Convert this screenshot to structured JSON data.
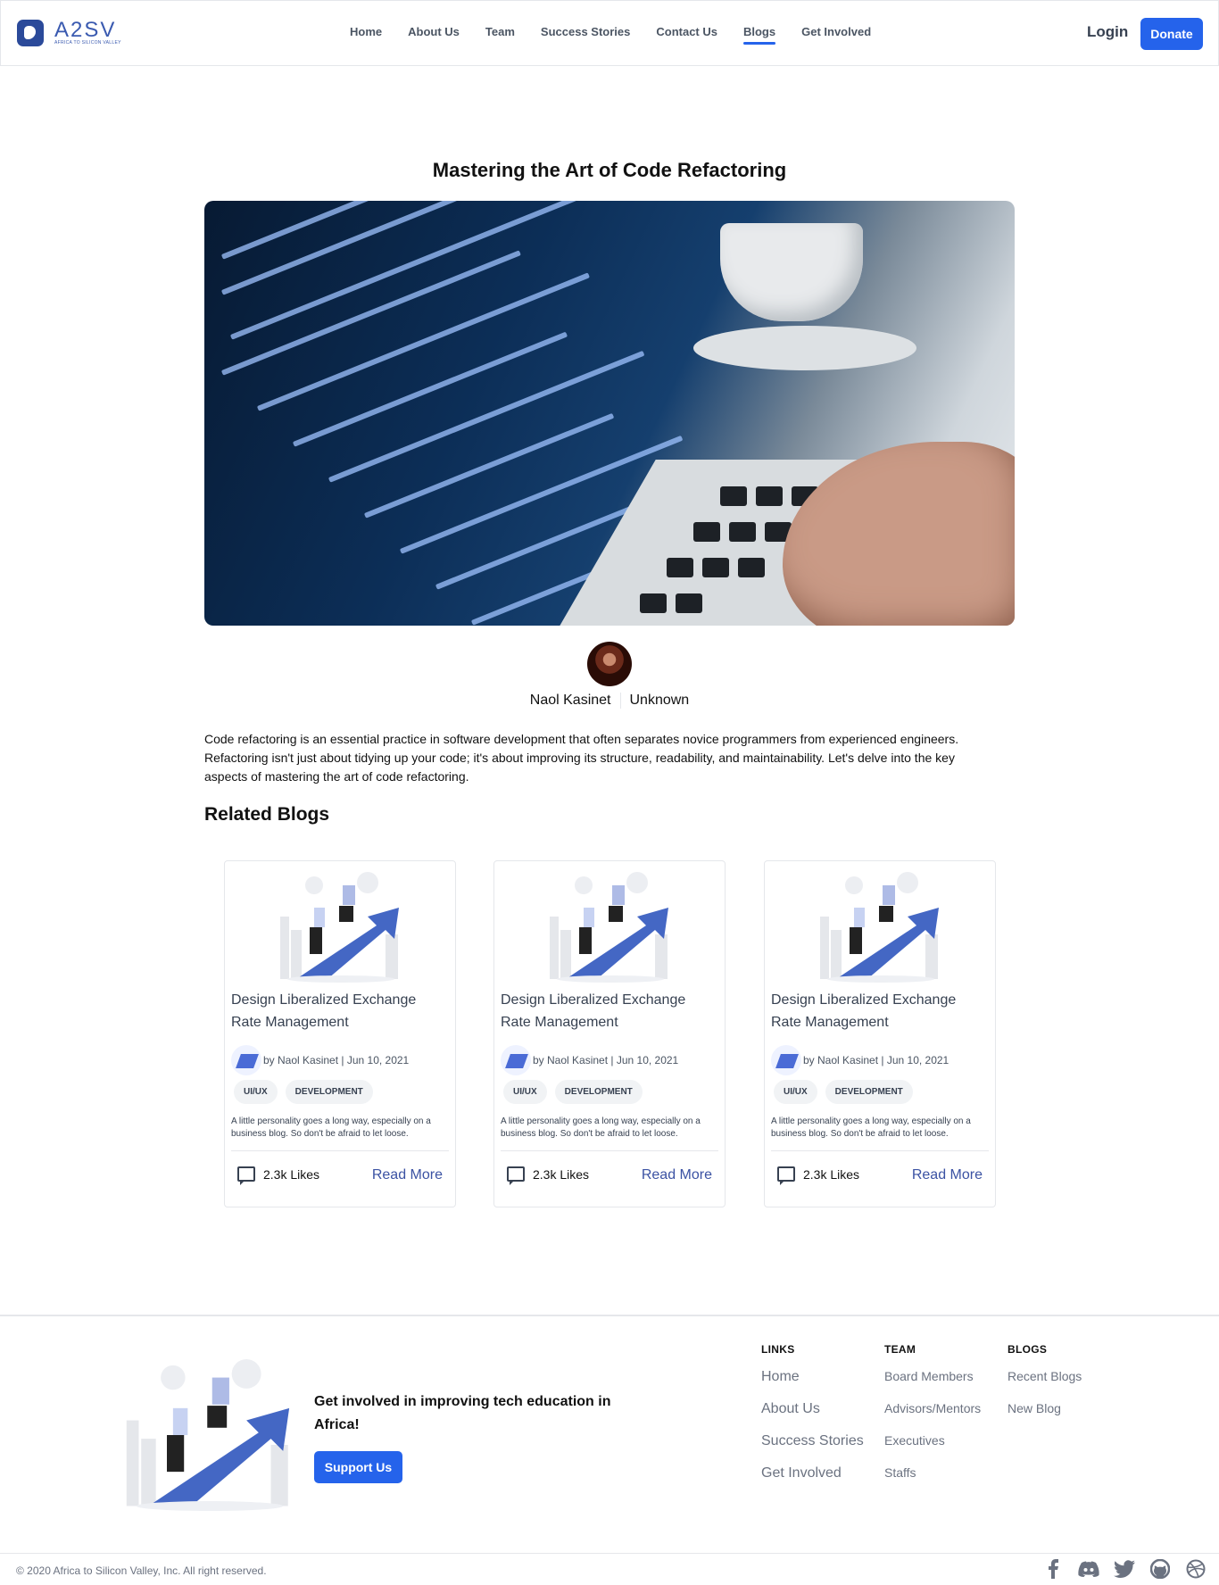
{
  "nav": {
    "logo_text": "A2SV",
    "logo_sub": "AFRICA TO SILICON VALLEY",
    "links": [
      "Home",
      "About Us",
      "Team",
      "Success Stories",
      "Contact Us",
      "Blogs",
      "Get Involved"
    ],
    "active": "Blogs",
    "login": "Login",
    "donate": "Donate"
  },
  "article": {
    "title": "Mastering the Art of Code Refactoring",
    "author": "Naol Kasinet",
    "role": "Unknown",
    "intro": "Code refactoring is an essential practice in software development that often separates novice programmers from experienced engineers. Refactoring isn't just about tidying up your code; it's about improving its structure, readability, and maintainability. Let's delve into the key aspects of mastering the art of code refactoring."
  },
  "related": {
    "title": "Related Blogs",
    "cards": [
      {
        "title": "Design Liberalized Exchange Rate Management",
        "meta": "by Naol Kasinet | Jun 10, 2021",
        "tags": [
          "UI/UX",
          "DEVELOPMENT"
        ],
        "desc": "A little personality goes a long way, especially on a business blog. So don't be afraid to let loose.",
        "likes": "2.3k Likes",
        "read_more": "Read More"
      },
      {
        "title": "Design Liberalized Exchange Rate Management",
        "meta": "by Naol Kasinet | Jun 10, 2021",
        "tags": [
          "UI/UX",
          "DEVELOPMENT"
        ],
        "desc": "A little personality goes a long way, especially on a business blog. So don't be afraid to let loose.",
        "likes": "2.3k Likes",
        "read_more": "Read More"
      },
      {
        "title": "Design Liberalized Exchange Rate Management",
        "meta": "by Naol Kasinet | Jun 10, 2021",
        "tags": [
          "UI/UX",
          "DEVELOPMENT"
        ],
        "desc": "A little personality goes a long way, especially on a business blog. So don't be afraid to let loose.",
        "likes": "2.3k Likes",
        "read_more": "Read More"
      }
    ]
  },
  "footer": {
    "cta": "Get involved in improving tech education in Africa!",
    "support": "Support Us",
    "links_head": "LINKS",
    "links": [
      "Home",
      "About Us",
      "Success Stories",
      "Get Involved"
    ],
    "team_head": "TEAM",
    "team": [
      "Board Members",
      "Advisors/Mentors",
      "Executives",
      "Staffs"
    ],
    "blogs_head": "BLOGS",
    "blogs": [
      "Recent Blogs",
      "New Blog"
    ],
    "copyright": "© 2020 Africa to Silicon Valley, Inc. All right reserved.",
    "socials": [
      "facebook-icon",
      "discord-icon",
      "twitter-icon",
      "github-icon",
      "dribbble-icon"
    ]
  },
  "colors": {
    "primary": "#2563eb",
    "link": "#3b52a3",
    "muted": "#6b7280"
  }
}
